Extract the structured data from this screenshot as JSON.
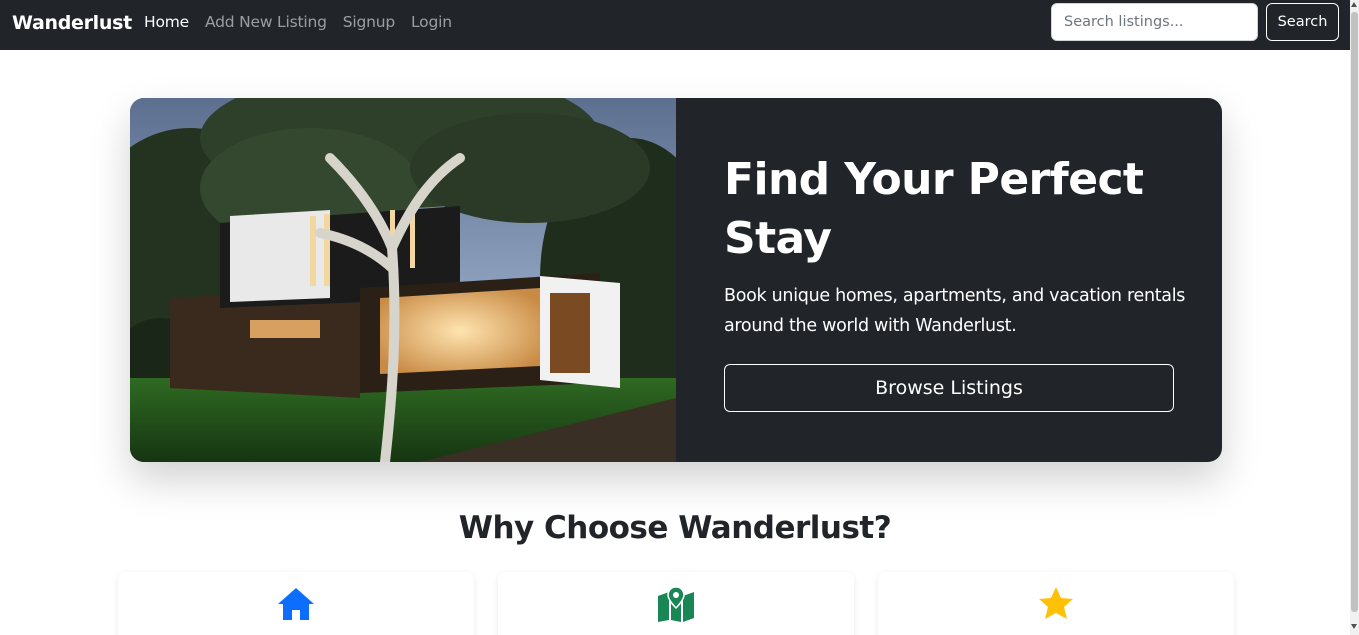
{
  "navbar": {
    "brand": "Wanderlust",
    "links": [
      {
        "label": "Home",
        "active": true
      },
      {
        "label": "Add New Listing",
        "active": false
      },
      {
        "label": "Signup",
        "active": false
      },
      {
        "label": "Login",
        "active": false
      }
    ],
    "search": {
      "placeholder": "Search listings...",
      "button_label": "Search"
    }
  },
  "hero": {
    "title": "Find Your Perfect Stay",
    "description": "Book unique homes, apartments, and vacation rentals around the world with Wanderlust.",
    "button_label": "Browse Listings",
    "image_subject": "modern-house-photo"
  },
  "features": {
    "title": "Why Choose Wanderlust?",
    "cards": [
      {
        "icon": "house-icon",
        "color": "#0d6efd"
      },
      {
        "icon": "map-location-icon",
        "color": "#198754"
      },
      {
        "icon": "star-icon",
        "color": "#ffc107"
      }
    ]
  },
  "colors": {
    "navbar_bg": "#212529",
    "hero_bg": "#212529",
    "primary": "#0d6efd",
    "success": "#198754",
    "warning": "#ffc107"
  }
}
